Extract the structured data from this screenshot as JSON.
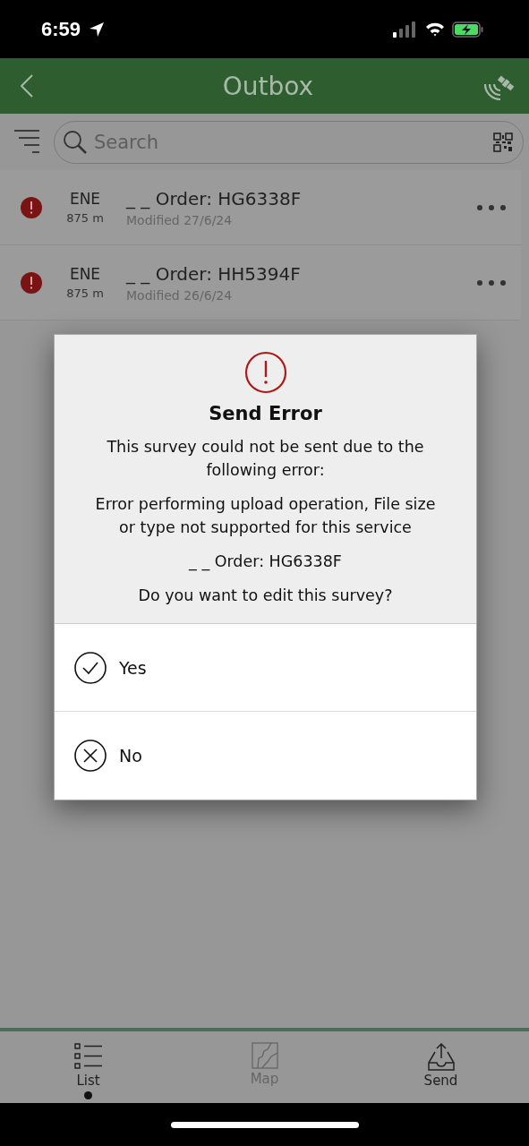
{
  "status_bar": {
    "time": "6:59"
  },
  "header": {
    "title": "Outbox"
  },
  "search": {
    "placeholder": "Search"
  },
  "surveys": [
    {
      "direction": "ENE",
      "distance": "875 m",
      "title": "_ _ Order: HG6338F",
      "modified": "Modified 27/6/24",
      "error": true
    },
    {
      "direction": "ENE",
      "distance": "875 m",
      "title": "_ _ Order: HH5394F",
      "modified": "Modified 26/6/24",
      "error": true
    }
  ],
  "dialog": {
    "title": "Send Error",
    "paragraphs": [
      "This survey could not be sent due to the following error:",
      "Error performing upload operation, File size or type not supported for this service",
      "_ _ Order: HG6338F",
      "Do you want to edit this survey?"
    ],
    "options": [
      {
        "kind": "confirm",
        "label": "Yes"
      },
      {
        "kind": "cancel",
        "label": "No"
      }
    ]
  },
  "tab_bar": [
    {
      "kind": "list",
      "label": "List",
      "selected": true,
      "disabled": false
    },
    {
      "kind": "map",
      "label": "Map",
      "selected": false,
      "disabled": true
    },
    {
      "kind": "send",
      "label": "Send",
      "selected": false,
      "disabled": false
    }
  ]
}
